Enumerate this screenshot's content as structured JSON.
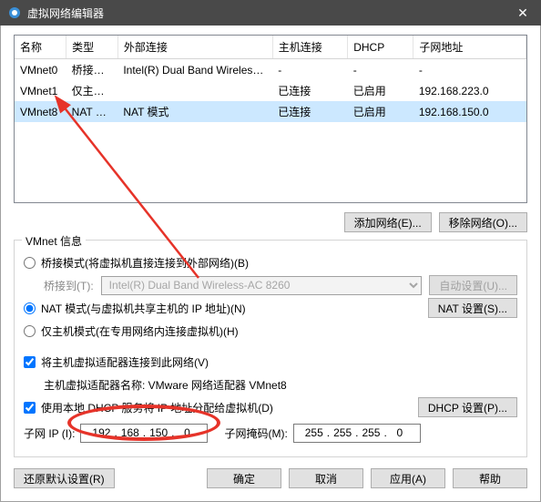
{
  "window": {
    "title": "虚拟网络编辑器"
  },
  "columns": [
    "名称",
    "类型",
    "外部连接",
    "主机连接",
    "DHCP",
    "子网地址"
  ],
  "colwidths": [
    "55",
    "55",
    "165",
    "80",
    "70",
    "120"
  ],
  "rows": [
    {
      "name": "VMnet0",
      "type": "桥接模式",
      "ext": "Intel(R) Dual Band Wireless-...",
      "host": "-",
      "dhcp": "-",
      "subnet": "-"
    },
    {
      "name": "VMnet1",
      "type": "仅主机...",
      "ext": "",
      "host": "已连接",
      "dhcp": "已启用",
      "subnet": "192.168.223.0"
    },
    {
      "name": "VMnet8",
      "type": "NAT 模式",
      "ext": "NAT 模式",
      "host": "已连接",
      "dhcp": "已启用",
      "subnet": "192.168.150.0"
    }
  ],
  "selected_row": 2,
  "buttons": {
    "add_net": "添加网络(E)...",
    "remove_net": "移除网络(O)..."
  },
  "group": {
    "title": "VMnet 信息",
    "bridge_radio": "桥接模式(将虚拟机直接连接到外部网络)(B)",
    "bridge_to": "桥接到(T):",
    "bridge_adapter": "Intel(R) Dual Band Wireless-AC 8260",
    "auto_settings": "自动设置(U)...",
    "nat_radio": "NAT 模式(与虚拟机共享主机的 IP 地址)(N)",
    "nat_settings": "NAT 设置(S)...",
    "hostonly_radio": "仅主机模式(在专用网络内连接虚拟机)(H)",
    "connect_host": "将主机虚拟适配器连接到此网络(V)",
    "host_adapter_label": "主机虚拟适配器名称: VMware 网络适配器 VMnet8",
    "use_dhcp": "使用本地 DHCP 服务将 IP 地址分配给虚拟机(D)",
    "dhcp_settings": "DHCP 设置(P)...",
    "subnet_ip_label": "子网 IP (I):",
    "subnet_mask_label": "子网掩码(M):",
    "subnet_ip": [
      "192",
      "168",
      "150",
      "0"
    ],
    "subnet_mask": [
      "255",
      "255",
      "255",
      "0"
    ]
  },
  "footer": {
    "restore": "还原默认设置(R)",
    "ok": "确定",
    "cancel": "取消",
    "apply": "应用(A)",
    "help": "帮助"
  }
}
